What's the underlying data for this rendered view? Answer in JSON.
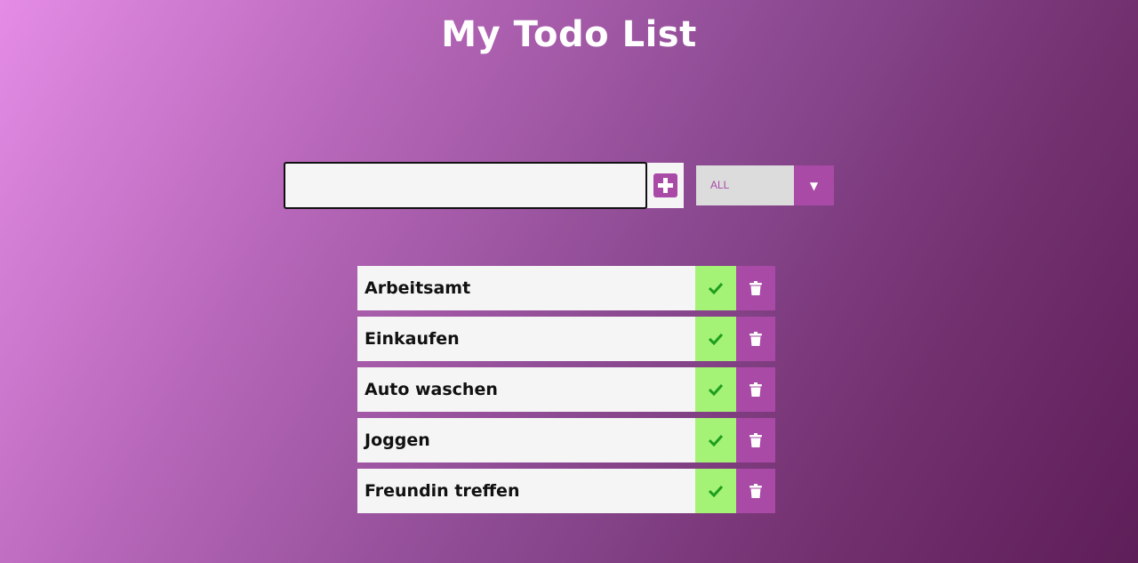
{
  "header": {
    "title": "My Todo List"
  },
  "form": {
    "input_value": "",
    "add_icon": "plus-square-icon",
    "filter": {
      "selected": "ALL",
      "arrow_glyph": "▼"
    }
  },
  "todos": [
    {
      "text": "Arbeitsamt"
    },
    {
      "text": "Einkaufen"
    },
    {
      "text": "Auto waschen"
    },
    {
      "text": "Joggen"
    },
    {
      "text": "Freundin treffen"
    }
  ],
  "icons": {
    "complete": "check-icon",
    "delete": "trash-icon"
  },
  "colors": {
    "accent": "#a94aa6",
    "complete_bg": "#a4f276",
    "check": "#1e9e1e",
    "item_bg": "#f5f5f5"
  }
}
